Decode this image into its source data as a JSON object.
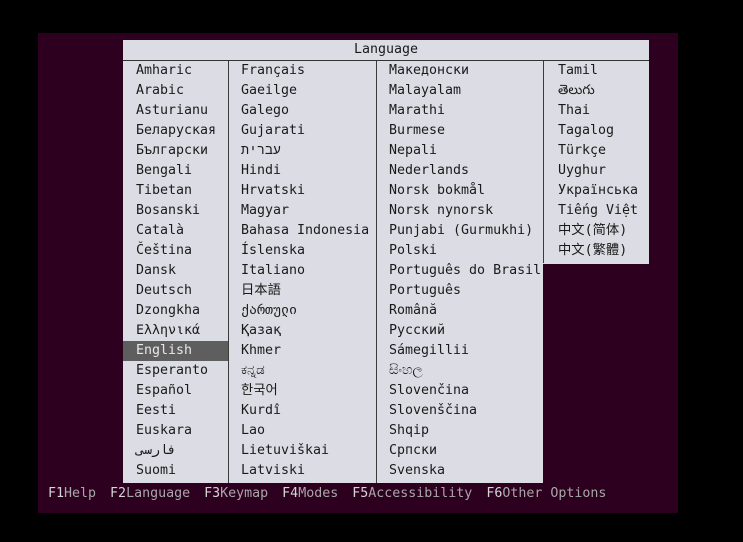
{
  "dialog": {
    "title": "Language"
  },
  "columns": [
    [
      "Amharic",
      "Arabic",
      "Asturianu",
      "Беларуская",
      "Български",
      "Bengali",
      "Tibetan",
      "Bosanski",
      "Català",
      "Čeština",
      "Dansk",
      "Deutsch",
      "Dzongkha",
      "Ελληνικά",
      "English",
      "Esperanto",
      "Español",
      "Eesti",
      "Euskara",
      "فارسی",
      "Suomi"
    ],
    [
      "Français",
      "Gaeilge",
      "Galego",
      "Gujarati",
      "עברית",
      "Hindi",
      "Hrvatski",
      "Magyar",
      "Bahasa Indonesia",
      "Íslenska",
      "Italiano",
      "日本語",
      "ქართული",
      "Қазақ",
      "Khmer",
      "ಕನ್ನಡ",
      "한국어",
      "Kurdî",
      "Lao",
      "Lietuviškai",
      "Latviski"
    ],
    [
      "Македонски",
      "Malayalam",
      "Marathi",
      "Burmese",
      "Nepali",
      "Nederlands",
      "Norsk bokmål",
      "Norsk nynorsk",
      "Punjabi (Gurmukhi)",
      "Polski",
      "Português do Brasil",
      "Português",
      "Română",
      "Русский",
      "Sámegillii",
      "සිංහල",
      "Slovenčina",
      "Slovenščina",
      "Shqip",
      "Српски",
      "Svenska"
    ],
    [
      "Tamil",
      "తెలుగు",
      "Thai",
      "Tagalog",
      "Türkçe",
      "Uyghur",
      "Українська",
      "Tiếng Việt",
      "中文(简体)",
      "中文(繁體)"
    ]
  ],
  "selected": "English",
  "function_bar": [
    {
      "key": "F1",
      "label": "Help"
    },
    {
      "key": "F2",
      "label": "Language"
    },
    {
      "key": "F3",
      "label": "Keymap"
    },
    {
      "key": "F4",
      "label": "Modes"
    },
    {
      "key": "F5",
      "label": "Accessibility"
    },
    {
      "key": "F6",
      "label": "Other Options"
    }
  ],
  "colors": {
    "background": "#2c001e",
    "dialog": "#dcdde4",
    "selection": "#5e5e5e",
    "footer_text": "#a7a7a7"
  }
}
